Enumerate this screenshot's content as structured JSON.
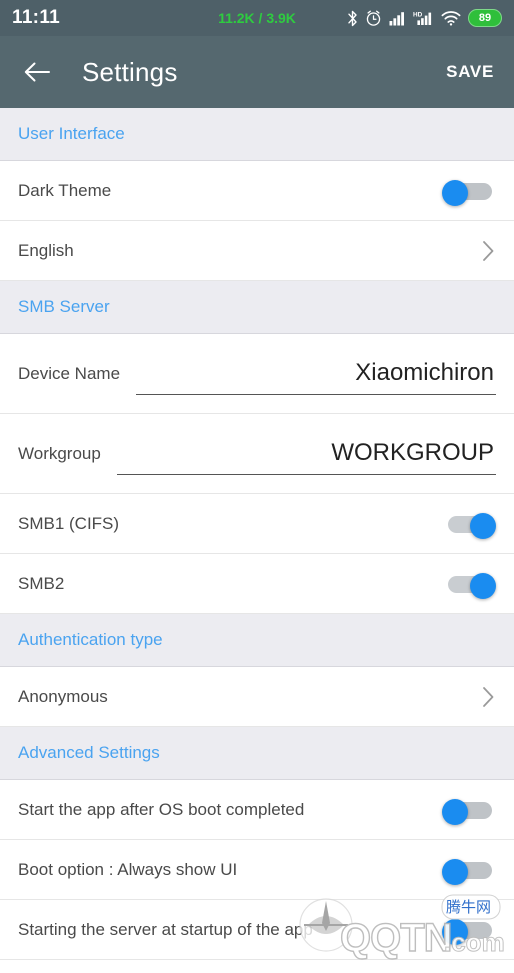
{
  "statusbar": {
    "clock": "11:11",
    "network_speed": "11.2K / 3.9K",
    "network_speed_color": "#2ECC40",
    "icons": [
      "bluetooth-icon",
      "alarm-icon",
      "signal-icon",
      "signal-hd-icon",
      "wifi-icon"
    ],
    "hd_label": "HD",
    "battery_level": "89",
    "battery_color": "#2FBF3B",
    "background_color": "#4E6068"
  },
  "appbar": {
    "back_icon": "back-arrow-icon",
    "title": "Settings",
    "save_label": "SAVE",
    "background_color": "#55686F"
  },
  "theme": {
    "accent_color": "#4AA3F0",
    "toggle_on_color": "#1A8CF0",
    "section_background": "#ECECF1",
    "label_color": "#4A4A4A"
  },
  "sections": [
    {
      "header": "User Interface",
      "rows": [
        {
          "label": "Dark Theme",
          "control": "toggle",
          "state": "off"
        },
        {
          "label": "English",
          "control": "chevron"
        }
      ]
    },
    {
      "header": "SMB Server",
      "rows": [
        {
          "label": "Device Name",
          "control": "textfield",
          "value": "Xiaomichiron"
        },
        {
          "label": "Workgroup",
          "control": "textfield",
          "value": "WORKGROUP"
        },
        {
          "label": "SMB1 (CIFS)",
          "control": "toggle",
          "state": "on"
        },
        {
          "label": "SMB2",
          "control": "toggle",
          "state": "on"
        }
      ]
    },
    {
      "header": "Authentication type",
      "rows": [
        {
          "label": "Anonymous",
          "control": "chevron"
        }
      ]
    },
    {
      "header": "Advanced Settings",
      "rows": [
        {
          "label": "Start the app after OS boot completed",
          "control": "toggle",
          "state": "off"
        },
        {
          "label": "Boot option : Always show UI",
          "control": "toggle",
          "state": "off"
        },
        {
          "label": "Starting the server at startup of the app",
          "control": "toggle",
          "state": "off"
        }
      ]
    }
  ],
  "watermark": {
    "site": "QQTN",
    "tld": ".com",
    "badge": "腾牛网"
  }
}
